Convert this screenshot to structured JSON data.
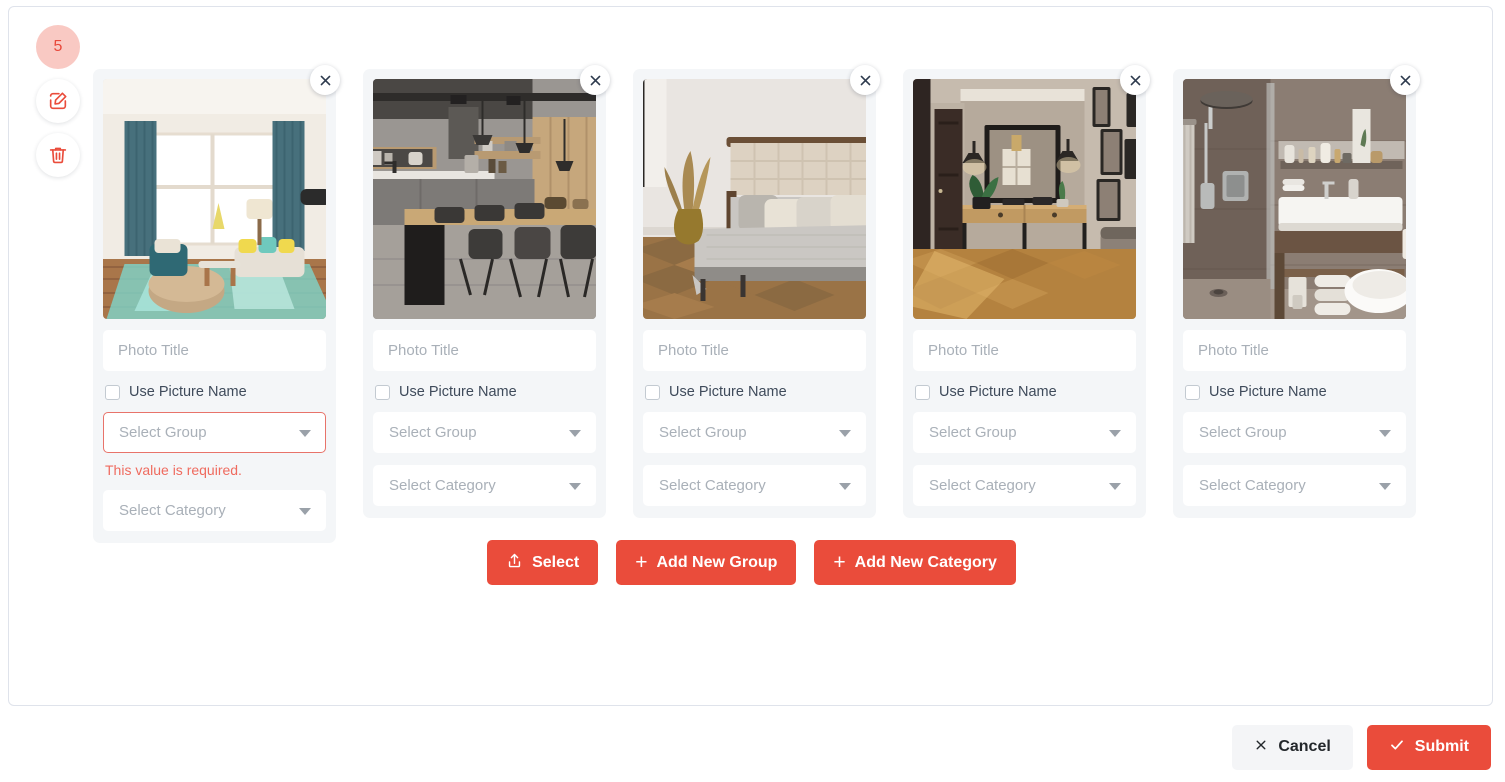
{
  "rail": {
    "badge_count": "5",
    "edit_icon": "edit-square-icon",
    "delete_icon": "trash-icon"
  },
  "form": {
    "title_placeholder": "Photo Title",
    "use_picture_name_label": "Use Picture Name",
    "select_group_placeholder": "Select Group",
    "select_category_placeholder": "Select Category",
    "required_error": "This value is required.",
    "close_icon": "close-icon",
    "caret_icon": "chevron-down-icon"
  },
  "cards": [
    {
      "title_value": "",
      "use_picture_name_checked": false,
      "group_value": "",
      "category_value": "",
      "group_error": "This value is required.",
      "has_error": true,
      "thumb_alt": "living-room-photo"
    },
    {
      "title_value": "",
      "use_picture_name_checked": false,
      "group_value": "",
      "category_value": "",
      "group_error": "",
      "has_error": false,
      "thumb_alt": "industrial-kitchen-photo"
    },
    {
      "title_value": "",
      "use_picture_name_checked": false,
      "group_value": "",
      "category_value": "",
      "group_error": "",
      "has_error": false,
      "thumb_alt": "bedroom-photo"
    },
    {
      "title_value": "",
      "use_picture_name_checked": false,
      "group_value": "",
      "category_value": "",
      "group_error": "",
      "has_error": false,
      "thumb_alt": "entryway-hallway-photo"
    },
    {
      "title_value": "",
      "use_picture_name_checked": false,
      "group_value": "",
      "category_value": "",
      "group_error": "",
      "has_error": false,
      "thumb_alt": "bathroom-photo"
    }
  ],
  "actions": {
    "select_label": "Select",
    "select_icon": "upload-icon",
    "add_group_label": "Add New Group",
    "add_category_label": "Add New Category",
    "plus_icon": "plus-icon"
  },
  "footer": {
    "cancel_label": "Cancel",
    "cancel_icon": "close-icon",
    "submit_label": "Submit",
    "submit_icon": "check-icon"
  },
  "colors": {
    "accent": "#ea4c3b",
    "badge_bg": "#f9c9c3",
    "card_bg": "#f4f6f8",
    "error_text": "#ef6b5f",
    "error_border": "#e8736a"
  }
}
